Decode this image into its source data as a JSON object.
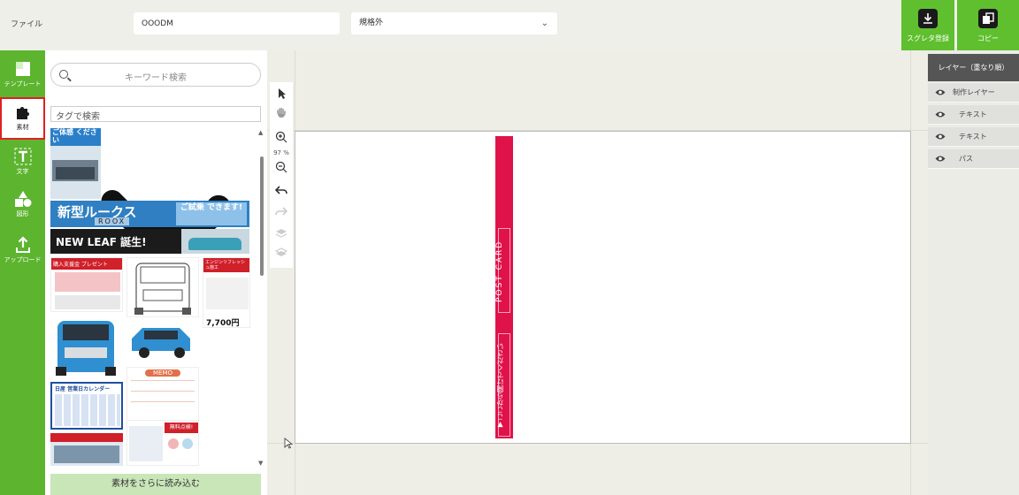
{
  "header": {
    "file_label": "ファイル",
    "document_name": "OOODM",
    "size_select": "規格外",
    "buttons": [
      {
        "label": "スグレタ登録",
        "icon": "download-icon"
      },
      {
        "label": "コピー",
        "icon": "copy-icon"
      }
    ]
  },
  "leftnav": {
    "items": [
      {
        "label": "テンプレート",
        "icon": "template-icon",
        "active": false
      },
      {
        "label": "素材",
        "icon": "puzzle-icon",
        "active": true
      },
      {
        "label": "文字",
        "icon": "text-icon",
        "active": false
      },
      {
        "label": "図形",
        "icon": "shapes-icon",
        "active": false
      },
      {
        "label": "アップロード",
        "icon": "upload-icon",
        "active": false
      }
    ]
  },
  "assets": {
    "search_placeholder": "キーワード検索",
    "tag_search": "タグで検索",
    "load_more": "素材をさらに読み込む",
    "thumbs": [
      {
        "text": "ご体感 ください"
      },
      {
        "text": "新型ルークス"
      },
      {
        "text": "ROOX"
      },
      {
        "text": "ご試乗 できます!"
      },
      {
        "text": "NEW LEAF 誕生!"
      },
      {
        "text": "購入支援金 プレゼント"
      },
      {
        "text": "エンジンリフレッシュ施工"
      },
      {
        "text": "7,700円"
      },
      {
        "text": "MEMO"
      },
      {
        "text": "日産 営業日カレンダー"
      },
      {
        "text": "無料点検!"
      }
    ]
  },
  "tools": {
    "zoom": "97 %",
    "items": [
      "select-icon",
      "hand-icon",
      "zoom-in-icon",
      "zoom-out-icon",
      "undo-icon",
      "redo-icon",
      "layer-up-icon",
      "layer-down-icon"
    ]
  },
  "canvas": {
    "stripe_text_1": "POST CARD",
    "stripe_text_2": "▼ここから開けてください"
  },
  "layers": {
    "title": "レイヤー（重なり順）",
    "items": [
      {
        "label": "制作レイヤー"
      },
      {
        "label": "テキスト"
      },
      {
        "label": "テキスト"
      },
      {
        "label": "パス"
      }
    ]
  },
  "colors": {
    "accent_green": "#5db42f",
    "button_green": "#5fbf2e",
    "stripe_red": "#e0124a",
    "active_border": "#e02020"
  }
}
